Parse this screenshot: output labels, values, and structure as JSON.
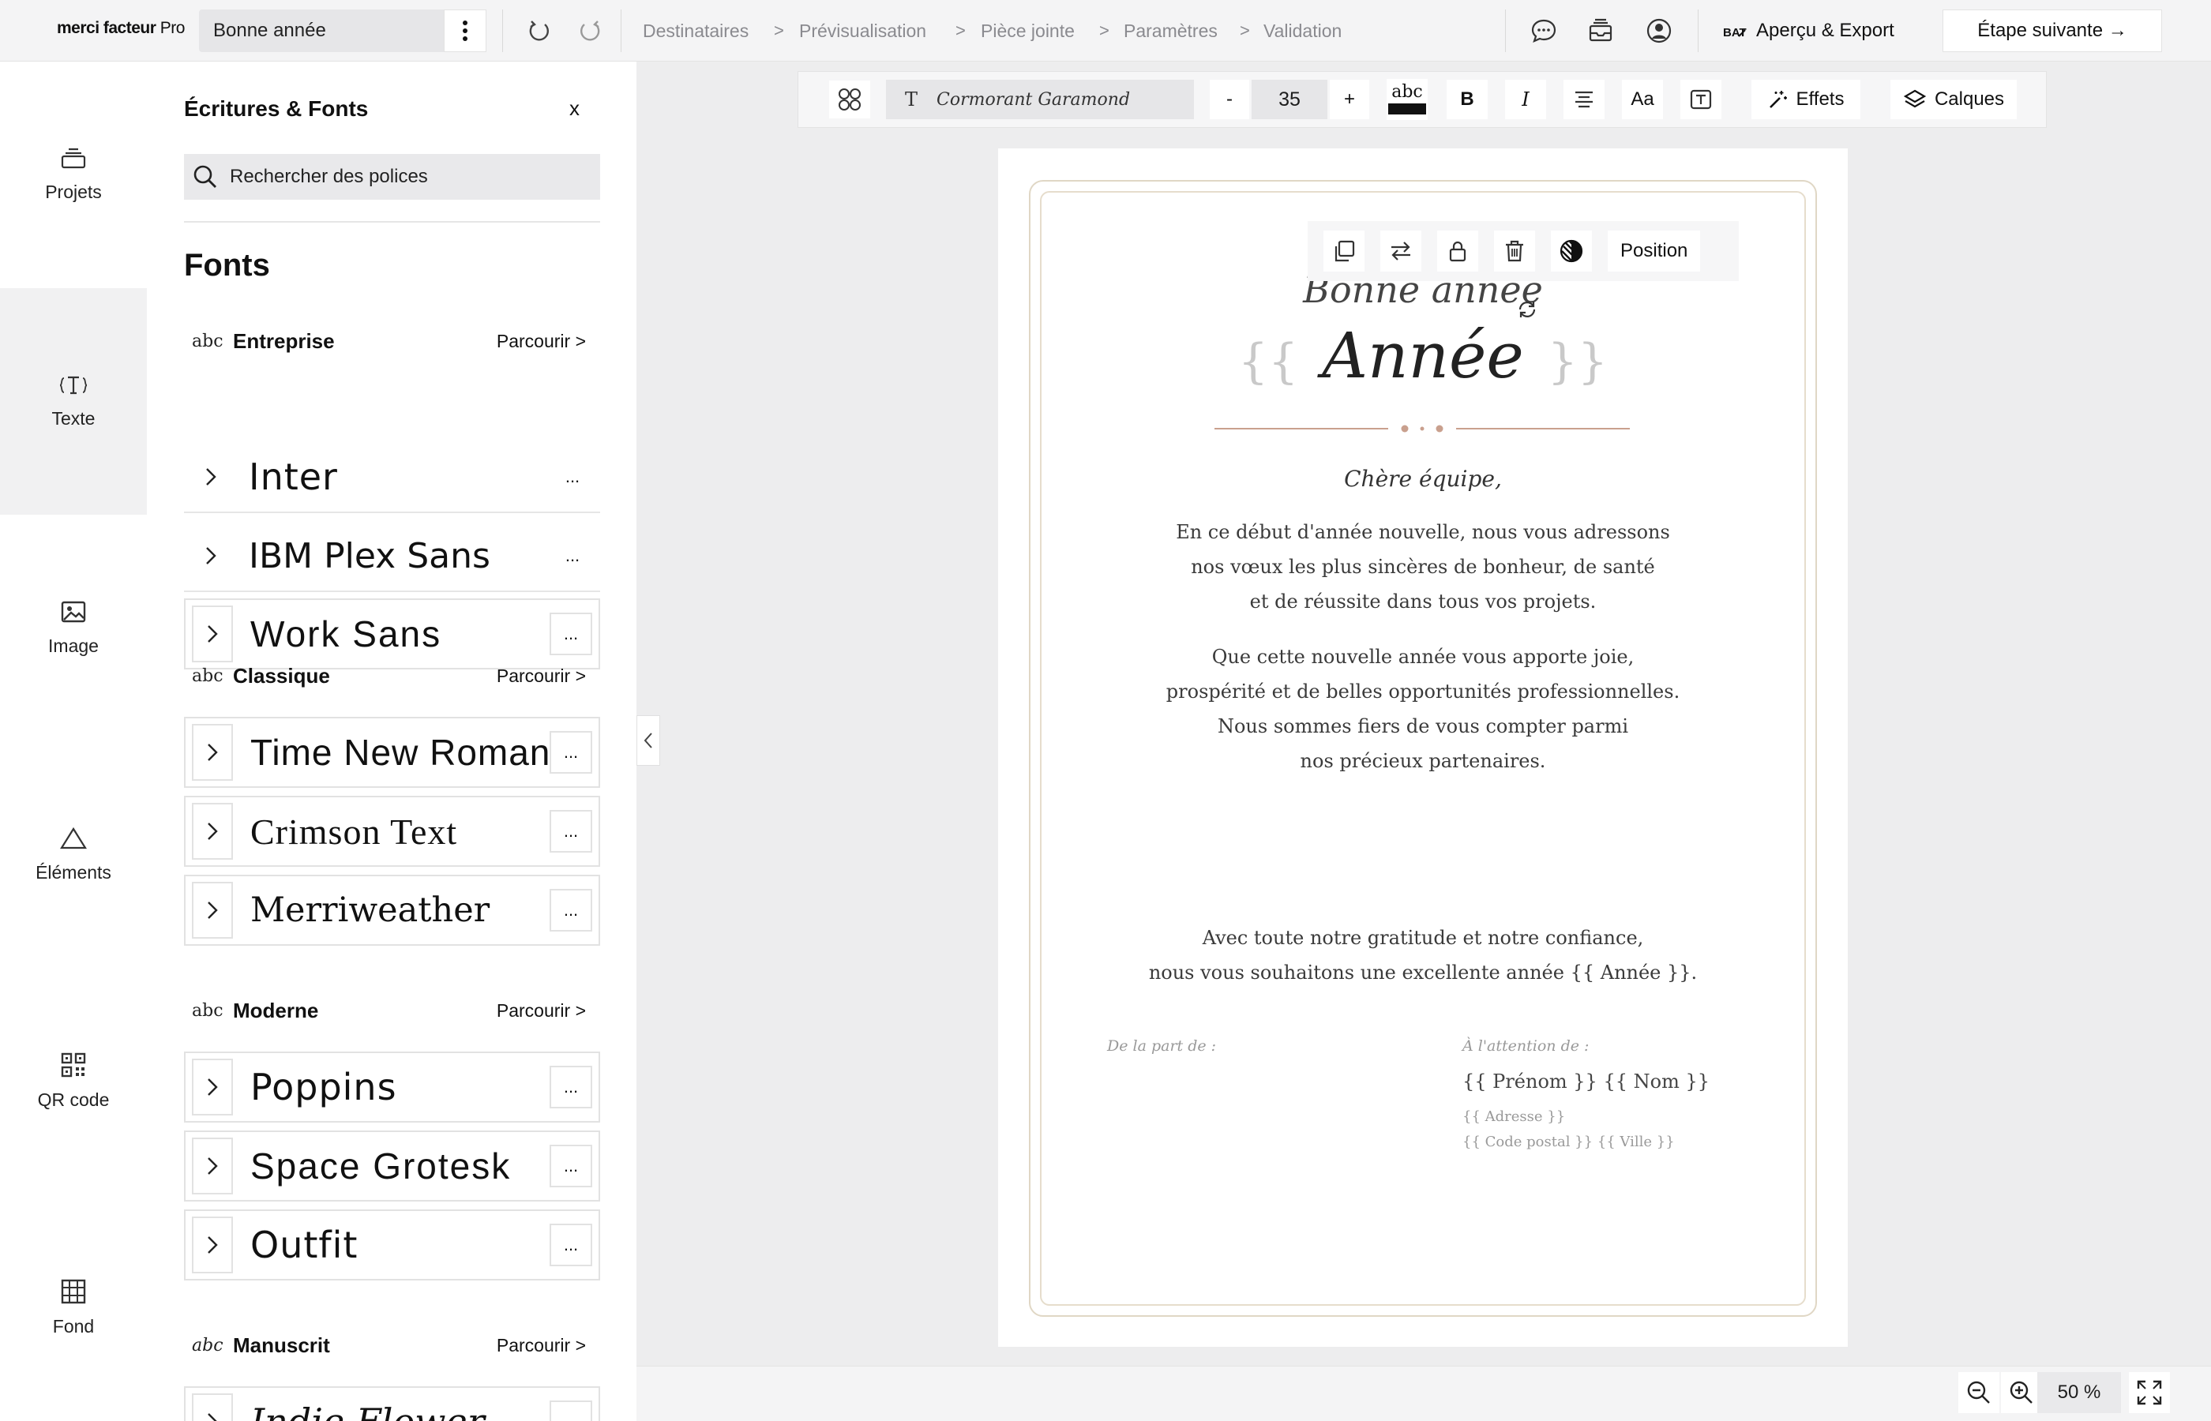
{
  "app": {
    "logo": "merci facteur",
    "logo_suffix": " Pro",
    "document_name": "Bonne année"
  },
  "breadcrumb": [
    "Destinataires",
    "Prévisualisation",
    "Pièce jointe",
    "Paramètres",
    "Validation"
  ],
  "breadcrumb_separator": ">",
  "header": {
    "export_label": "Aperçu & Export",
    "next_label": "Étape suivante →"
  },
  "rail": [
    {
      "label": "Projets",
      "icon": "stack-icon"
    },
    {
      "label": "Texte",
      "icon": "text-icon",
      "active": true
    },
    {
      "label": "Image",
      "icon": "image-icon"
    },
    {
      "label": "Éléments",
      "icon": "triangle-icon"
    },
    {
      "label": "QR code",
      "icon": "qr-code-icon"
    },
    {
      "label": "Fond",
      "icon": "grid-icon"
    }
  ],
  "panel": {
    "title": "Écritures & Fonts",
    "close": "x",
    "search_placeholder": "Rechercher des polices",
    "section_title": "Fonts",
    "categories": [
      {
        "abc": "abc",
        "name": "Entreprise",
        "browse": "Parcourir >",
        "fonts": [
          "Inter",
          "IBM Plex Sans",
          "Work Sans"
        ]
      },
      {
        "abc": "abc",
        "name": "Classique",
        "browse": "Parcourir >",
        "fonts": [
          "Time New Roman",
          "Crimson Text",
          "Merriweather"
        ]
      },
      {
        "abc": "abc",
        "name": "Moderne",
        "browse": "Parcourir >",
        "fonts": [
          "Poppins",
          "Space Grotesk",
          "Outfit"
        ]
      },
      {
        "abc": "abc",
        "name": "Manuscrit",
        "browse": "Parcourir >",
        "fonts": [
          "Indie Flower"
        ]
      }
    ],
    "more_label": "..."
  },
  "format_bar": {
    "font_family": "Cormorant Garamond",
    "font_icon": "T",
    "minus": "-",
    "size": "35",
    "plus": "+",
    "color_swatch_label": "abc",
    "color": "#111111",
    "bold": "B",
    "italic": "I",
    "case": "Aa",
    "effects_label": "Effets",
    "layers_label": "Calques"
  },
  "context_toolbar": {
    "position_label": "Position"
  },
  "letter": {
    "title_line1": "Bonne année",
    "title_line2": "Année",
    "brace_open": "{{",
    "brace_close": "}}",
    "salutation": "Chère équipe,",
    "paragraph1": [
      "En ce début d'année nouvelle, nous vous adressons",
      "nos vœux les plus sincères de bonheur, de santé",
      "et de réussite dans tous vos projets."
    ],
    "paragraph2": [
      "Que cette nouvelle année vous apporte joie,",
      "prospérité et de belles opportunités professionnelles.",
      "Nous sommes fiers de vous compter parmi",
      "nos précieux partenaires."
    ],
    "closing": [
      "Avec toute notre gratitude et notre confiance,",
      "nous vous souhaitons une excellente année {{ Année }}."
    ],
    "from_label": "De la part de :",
    "to_label": "À l'attention de :",
    "recipient_name": "{{ Prénom }} {{ Nom }}",
    "recipient_address": "{{ Adresse }}",
    "recipient_city": "{{ Code postal }} {{ Ville }}",
    "accent_color": "#c9a08e"
  },
  "zoom": {
    "value": "50 %"
  }
}
